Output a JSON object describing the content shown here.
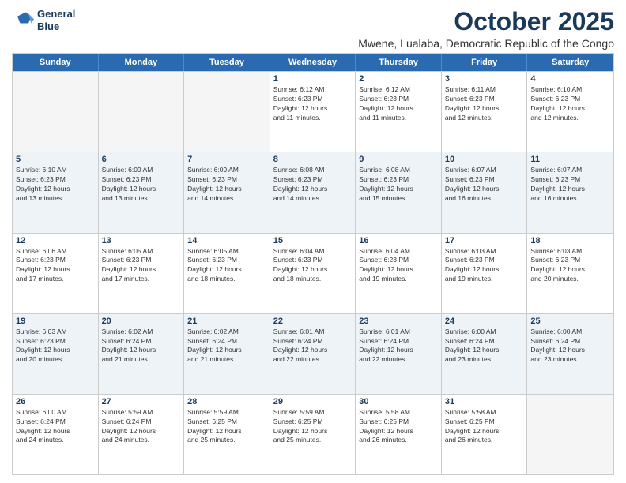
{
  "logo": {
    "line1": "General",
    "line2": "Blue"
  },
  "title": "October 2025",
  "location": "Mwene, Lualaba, Democratic Republic of the Congo",
  "days_of_week": [
    "Sunday",
    "Monday",
    "Tuesday",
    "Wednesday",
    "Thursday",
    "Friday",
    "Saturday"
  ],
  "weeks": [
    [
      {
        "day": "",
        "info": ""
      },
      {
        "day": "",
        "info": ""
      },
      {
        "day": "",
        "info": ""
      },
      {
        "day": "1",
        "info": "Sunrise: 6:12 AM\nSunset: 6:23 PM\nDaylight: 12 hours\nand 11 minutes."
      },
      {
        "day": "2",
        "info": "Sunrise: 6:12 AM\nSunset: 6:23 PM\nDaylight: 12 hours\nand 11 minutes."
      },
      {
        "day": "3",
        "info": "Sunrise: 6:11 AM\nSunset: 6:23 PM\nDaylight: 12 hours\nand 12 minutes."
      },
      {
        "day": "4",
        "info": "Sunrise: 6:10 AM\nSunset: 6:23 PM\nDaylight: 12 hours\nand 12 minutes."
      }
    ],
    [
      {
        "day": "5",
        "info": "Sunrise: 6:10 AM\nSunset: 6:23 PM\nDaylight: 12 hours\nand 13 minutes."
      },
      {
        "day": "6",
        "info": "Sunrise: 6:09 AM\nSunset: 6:23 PM\nDaylight: 12 hours\nand 13 minutes."
      },
      {
        "day": "7",
        "info": "Sunrise: 6:09 AM\nSunset: 6:23 PM\nDaylight: 12 hours\nand 14 minutes."
      },
      {
        "day": "8",
        "info": "Sunrise: 6:08 AM\nSunset: 6:23 PM\nDaylight: 12 hours\nand 14 minutes."
      },
      {
        "day": "9",
        "info": "Sunrise: 6:08 AM\nSunset: 6:23 PM\nDaylight: 12 hours\nand 15 minutes."
      },
      {
        "day": "10",
        "info": "Sunrise: 6:07 AM\nSunset: 6:23 PM\nDaylight: 12 hours\nand 16 minutes."
      },
      {
        "day": "11",
        "info": "Sunrise: 6:07 AM\nSunset: 6:23 PM\nDaylight: 12 hours\nand 16 minutes."
      }
    ],
    [
      {
        "day": "12",
        "info": "Sunrise: 6:06 AM\nSunset: 6:23 PM\nDaylight: 12 hours\nand 17 minutes."
      },
      {
        "day": "13",
        "info": "Sunrise: 6:05 AM\nSunset: 6:23 PM\nDaylight: 12 hours\nand 17 minutes."
      },
      {
        "day": "14",
        "info": "Sunrise: 6:05 AM\nSunset: 6:23 PM\nDaylight: 12 hours\nand 18 minutes."
      },
      {
        "day": "15",
        "info": "Sunrise: 6:04 AM\nSunset: 6:23 PM\nDaylight: 12 hours\nand 18 minutes."
      },
      {
        "day": "16",
        "info": "Sunrise: 6:04 AM\nSunset: 6:23 PM\nDaylight: 12 hours\nand 19 minutes."
      },
      {
        "day": "17",
        "info": "Sunrise: 6:03 AM\nSunset: 6:23 PM\nDaylight: 12 hours\nand 19 minutes."
      },
      {
        "day": "18",
        "info": "Sunrise: 6:03 AM\nSunset: 6:23 PM\nDaylight: 12 hours\nand 20 minutes."
      }
    ],
    [
      {
        "day": "19",
        "info": "Sunrise: 6:03 AM\nSunset: 6:23 PM\nDaylight: 12 hours\nand 20 minutes."
      },
      {
        "day": "20",
        "info": "Sunrise: 6:02 AM\nSunset: 6:24 PM\nDaylight: 12 hours\nand 21 minutes."
      },
      {
        "day": "21",
        "info": "Sunrise: 6:02 AM\nSunset: 6:24 PM\nDaylight: 12 hours\nand 21 minutes."
      },
      {
        "day": "22",
        "info": "Sunrise: 6:01 AM\nSunset: 6:24 PM\nDaylight: 12 hours\nand 22 minutes."
      },
      {
        "day": "23",
        "info": "Sunrise: 6:01 AM\nSunset: 6:24 PM\nDaylight: 12 hours\nand 22 minutes."
      },
      {
        "day": "24",
        "info": "Sunrise: 6:00 AM\nSunset: 6:24 PM\nDaylight: 12 hours\nand 23 minutes."
      },
      {
        "day": "25",
        "info": "Sunrise: 6:00 AM\nSunset: 6:24 PM\nDaylight: 12 hours\nand 23 minutes."
      }
    ],
    [
      {
        "day": "26",
        "info": "Sunrise: 6:00 AM\nSunset: 6:24 PM\nDaylight: 12 hours\nand 24 minutes."
      },
      {
        "day": "27",
        "info": "Sunrise: 5:59 AM\nSunset: 6:24 PM\nDaylight: 12 hours\nand 24 minutes."
      },
      {
        "day": "28",
        "info": "Sunrise: 5:59 AM\nSunset: 6:25 PM\nDaylight: 12 hours\nand 25 minutes."
      },
      {
        "day": "29",
        "info": "Sunrise: 5:59 AM\nSunset: 6:25 PM\nDaylight: 12 hours\nand 25 minutes."
      },
      {
        "day": "30",
        "info": "Sunrise: 5:58 AM\nSunset: 6:25 PM\nDaylight: 12 hours\nand 26 minutes."
      },
      {
        "day": "31",
        "info": "Sunrise: 5:58 AM\nSunset: 6:25 PM\nDaylight: 12 hours\nand 26 minutes."
      },
      {
        "day": "",
        "info": ""
      }
    ]
  ]
}
